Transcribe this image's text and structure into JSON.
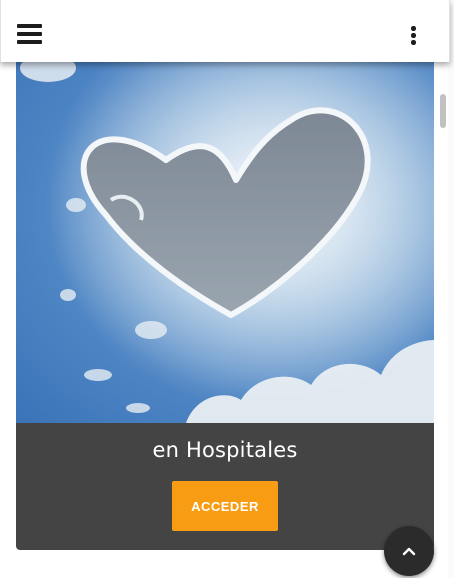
{
  "app_bar": {
    "menu_icon": "hamburger-menu-icon",
    "overflow_icon": "more-vertical-icon"
  },
  "card": {
    "image_description_icon": "heart-cloud-image",
    "title": "en Hospitales",
    "button_label": "ACCEDER"
  },
  "scroll_top": {
    "icon": "chevron-up-icon"
  },
  "colors": {
    "appbar_bg": "#ffffff",
    "card_bg": "#444444",
    "accent": "#f89c14",
    "fab_bg": "#2b2b2b"
  }
}
